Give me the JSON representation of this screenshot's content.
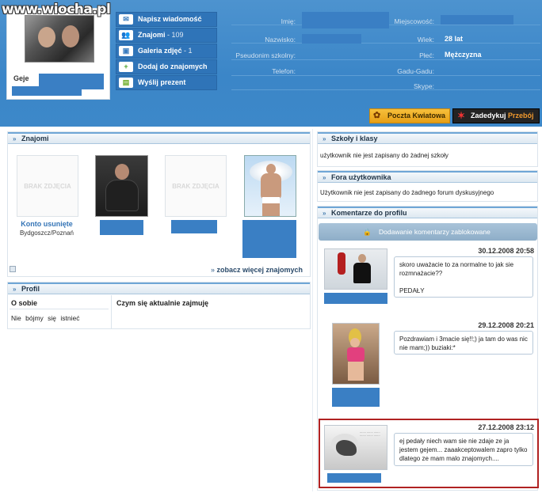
{
  "watermark": "www.wiocha.pl",
  "profile": {
    "name": "Geje"
  },
  "menu": [
    {
      "label": "Napisz wiadomość",
      "count": "",
      "icon": "envelope-icon",
      "glyph": "✉"
    },
    {
      "label": "Znajomi",
      "count": "- 109",
      "icon": "friends-icon",
      "glyph": "👥"
    },
    {
      "label": "Galeria zdjęć",
      "count": "- 1",
      "icon": "gallery-icon",
      "glyph": "▣"
    },
    {
      "label": "Dodaj do znajomych",
      "count": "",
      "icon": "add-friend-icon",
      "glyph": "+"
    },
    {
      "label": "Wyślij prezent",
      "count": "",
      "icon": "gift-icon",
      "glyph": "▤"
    }
  ],
  "info": {
    "imie_label": "Imię:",
    "miejscowosc_label": "Miejscowość:",
    "nazwisko_label": "Nazwisko:",
    "wiek_label": "Wiek:",
    "wiek_value": "28 lat",
    "pseudonim_label": "Pseudonim szkolny:",
    "plec_label": "Płeć:",
    "plec_value": "Mężczyzna",
    "telefon_label": "Telefon:",
    "gg_label": "Gadu-Gadu:",
    "skype_label": "Skype:"
  },
  "actions": {
    "poczta": "Poczta Kwiatowa",
    "dedykuj": "Zadedykuj",
    "przeboj": "Przebój"
  },
  "znajomi": {
    "title": "Znajomi",
    "no_photo": "BRAK ZDJĘCIA",
    "removed_name": "Konto usunięte",
    "removed_city": "Bydgoszcz/Poznań",
    "more_link": "zobacz więcej znajomych"
  },
  "profil": {
    "title": "Profil",
    "o_sobie_label": "O sobie",
    "o_sobie_value": "Nie bójmy się istnieć",
    "zajmuje_label": "Czym się aktualnie zajmuję"
  },
  "szkoly": {
    "title": "Szkoły i klasy",
    "text": "użytkownik nie jest zapisany do żadnej szkoły"
  },
  "fora": {
    "title": "Fora użytkownika",
    "text": "Użytkownik nie jest zapisany do żadnego forum dyskusyjnego"
  },
  "komentarze": {
    "title": "Komentarze do profilu",
    "locked": "Dodawanie komentarzy zablokowane",
    "items": [
      {
        "date": "30.12.2008 20:58",
        "text": "skoro uważacie to za normalne to jak sie rozmnażacie??\n\nPEDAŁY"
      },
      {
        "date": "29.12.2008 20:21",
        "text": "Pozdrawiam i 3macie się!!;) ja tam do was nic nie mam;)) buziaki:*"
      },
      {
        "date": "27.12.2008 23:12",
        "text": "ej pedały niech wam sie nie zdaje ze ja jestem gejem... zaaakceptowalem zapro tylko dlatego ze mam malo znajomych...."
      }
    ]
  }
}
